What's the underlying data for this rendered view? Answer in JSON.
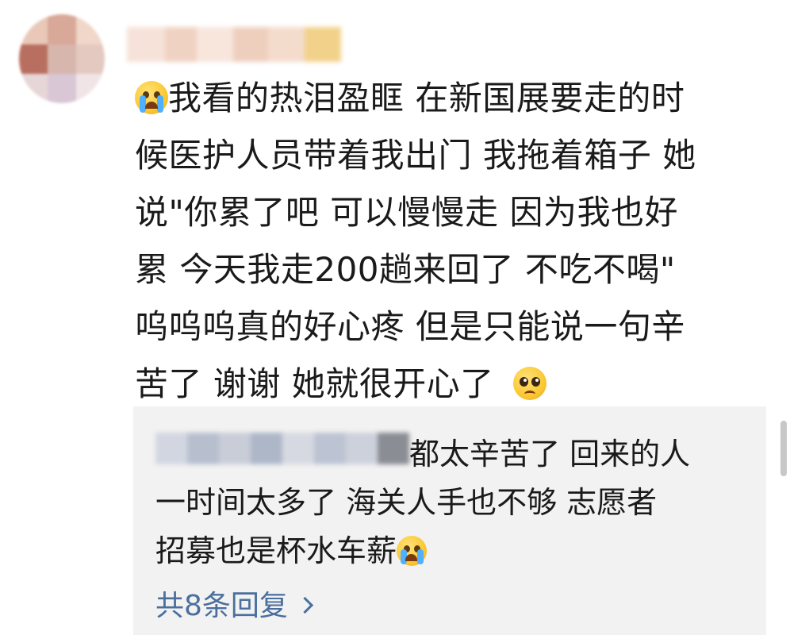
{
  "comment": {
    "lines": [
      "我看的热泪盈眶 在新国展要走的时",
      "候医护人员带着我出门 我拖着箱子 她",
      "说\"你累了吧 可以慢慢走 因为我也好",
      "累 今天我走200趟来回了 不吃不喝\"",
      "呜呜呜真的好心疼 但是只能说一句辛",
      "苦了 谢谢 她就很开心了"
    ],
    "leading_emoji": "crying-emoji",
    "trailing_emoji": "pleading-emoji"
  },
  "reply": {
    "lines": [
      "都太辛苦了 回来的人",
      "一时间太多了 海关人手也不够 志愿者",
      "招募也是杯水车薪"
    ],
    "trailing_emoji": "crying-emoji"
  },
  "more_replies": {
    "label": "共8条回复"
  },
  "colors": {
    "link": "#4b6f9d",
    "reply_bg": "#f2f2f2",
    "text": "#1a1a1a"
  }
}
